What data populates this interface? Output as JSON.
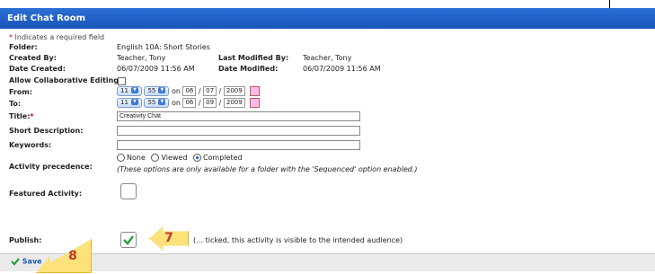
{
  "header": {
    "title": "Edit Chat Room"
  },
  "required_note": "Indicates a required field",
  "required_star": "*",
  "folder": {
    "label": "Folder:",
    "value": "English 10A: Short Stories"
  },
  "created_by": {
    "label": "Created By:",
    "value": "Teacher, Tony"
  },
  "last_modified_by": {
    "label": "Last Modified By:",
    "value": "Teacher, Tony"
  },
  "date_created": {
    "label": "Date Created:",
    "value": "06/07/2009 11:56 AM"
  },
  "date_modified": {
    "label": "Date Modified:",
    "value": "06/07/2009 11:56 AM"
  },
  "allow_collab": {
    "label": "Allow Collaborative Editing:"
  },
  "from": {
    "label": "From:",
    "hour": "11",
    "minute": "55",
    "on": "on",
    "month": "06",
    "day": "07",
    "year": "2009"
  },
  "to": {
    "label": "To:",
    "hour": "11",
    "minute": "55",
    "on": "on",
    "month": "06",
    "day": "09",
    "year": "2009"
  },
  "title": {
    "label": "Title:",
    "value": "Creativity Chat"
  },
  "short_description": {
    "label": "Short Description:",
    "value": ""
  },
  "keywords": {
    "label": "Keywords:",
    "value": ""
  },
  "activity_precedence": {
    "label": "Activity precedence:",
    "options": [
      "None",
      "Viewed",
      "Completed"
    ],
    "selected": "Completed",
    "note": "(These options are only available for a folder with the 'Sequenced' option enabled.)"
  },
  "featured_activity": {
    "label": "Featured Activity:"
  },
  "publish": {
    "label": "Publish:",
    "note": "(… ticked, this activity is visible to the intended audience)"
  },
  "footer": {
    "save_label": "Save"
  },
  "callouts": {
    "seven": "7",
    "eight": "8"
  },
  "colors": {
    "header": "#1a55b8",
    "callout": "#fbe27a"
  },
  "icons": {
    "save": "checkmark-icon",
    "publish": "checkmark-icon",
    "calendar": "calendar-icon"
  }
}
